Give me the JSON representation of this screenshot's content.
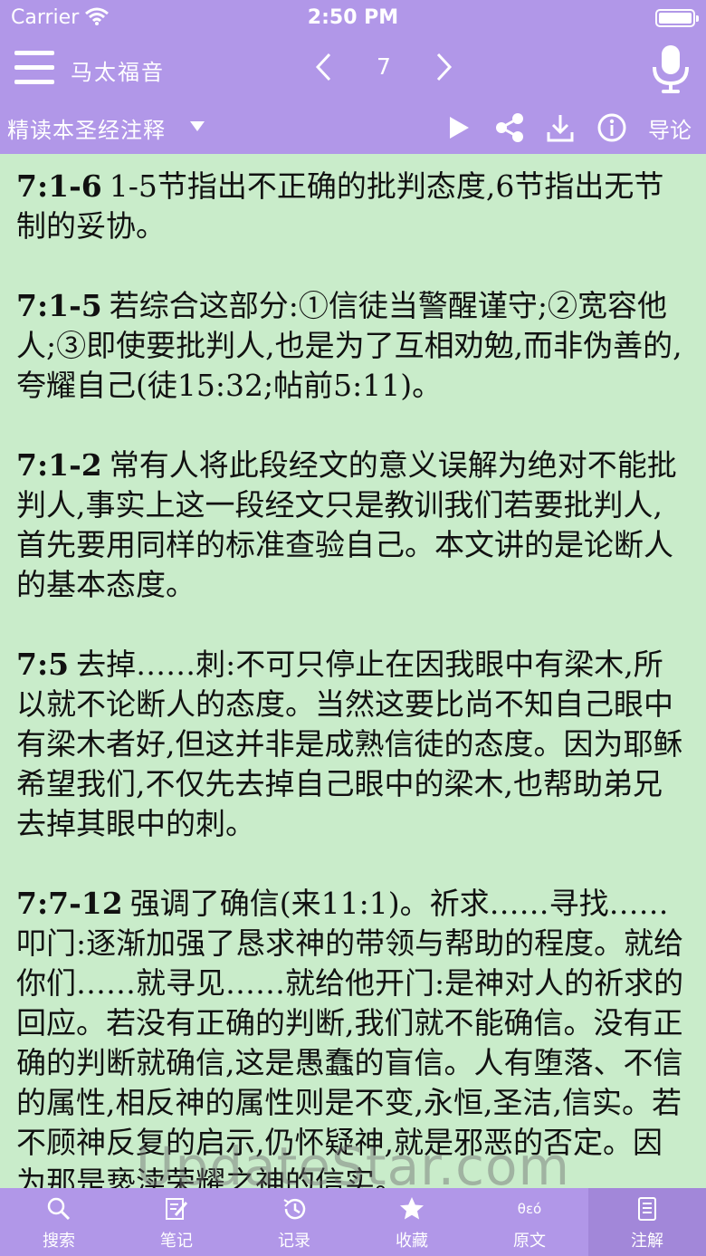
{
  "status": {
    "carrier": "Carrier",
    "time": "2:50 PM"
  },
  "nav": {
    "book_title": "马太福音",
    "chapter": "7"
  },
  "toolbar": {
    "source": "精读本圣经注释",
    "intro_label": "导论"
  },
  "notes": [
    {
      "ref": "7:1-6",
      "text": "1-5节指出不正确的批判态度,6节指出无节制的妥协。"
    },
    {
      "ref": "7:1-5",
      "text": "若综合这部分:①信徒当警醒谨守;②宽容他人;③即使要批判人,也是为了互相劝勉,而非伪善的,夸耀自己(徒15:32;帖前5:11)。"
    },
    {
      "ref": "7:1-2",
      "text": "常有人将此段经文的意义误解为绝对不能批判人,事实上这一段经文只是教训我们若要批判人,首先要用同样的标准查验自己。本文讲的是论断人的基本态度。"
    },
    {
      "ref": "7:5",
      "text": "去掉……刺:不可只停止在因我眼中有梁木,所以就不论断人的态度。当然这要比尚不知自己眼中有梁木者好,但这并非是成熟信徒的态度。因为耶稣希望我们,不仅先去掉自己眼中的梁木,也帮助弟兄去掉其眼中的刺。"
    },
    {
      "ref": "7:7-12",
      "text": "强调了确信(来11:1)。祈求……寻找……叩门:逐渐加强了恳求神的带领与帮助的程度。就给你们……就寻见……就给他开门:是神对人的祈求的回应。若没有正确的判断,我们就不能确信。没有正确的判断就确信,这是愚蠢的盲信。人有堕落、不信的属性,相反神的属性则是不变,永恒,圣洁,信实。若不顾神反复的启示,仍怀疑神,就是邪恶的否定。因为那是亵渎荣耀之神的信实。"
    }
  ],
  "watermark": "UpdateStar.com",
  "tabs": [
    {
      "label": "搜索"
    },
    {
      "label": "笔记"
    },
    {
      "label": "记录"
    },
    {
      "label": "收藏"
    },
    {
      "label": "原文",
      "glyph": "θεό"
    },
    {
      "label": "注解"
    }
  ],
  "colors": {
    "header": "#b197e8",
    "content_bg": "#c9ecca",
    "active_tab": "#a287d9"
  }
}
